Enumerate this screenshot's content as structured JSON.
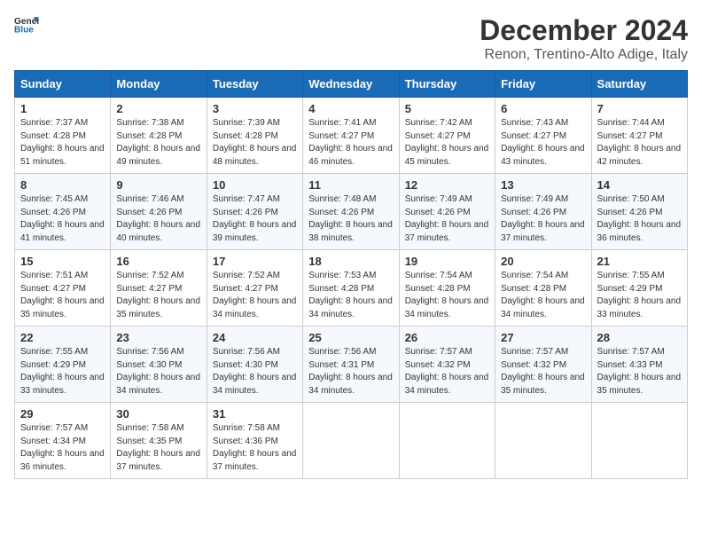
{
  "logo": {
    "text_general": "General",
    "text_blue": "Blue"
  },
  "title": "December 2024",
  "subtitle": "Renon, Trentino-Alto Adige, Italy",
  "days_of_week": [
    "Sunday",
    "Monday",
    "Tuesday",
    "Wednesday",
    "Thursday",
    "Friday",
    "Saturday"
  ],
  "weeks": [
    [
      {
        "day": "1",
        "sunrise": "7:37 AM",
        "sunset": "4:28 PM",
        "daylight": "8 hours and 51 minutes."
      },
      {
        "day": "2",
        "sunrise": "7:38 AM",
        "sunset": "4:28 PM",
        "daylight": "8 hours and 49 minutes."
      },
      {
        "day": "3",
        "sunrise": "7:39 AM",
        "sunset": "4:28 PM",
        "daylight": "8 hours and 48 minutes."
      },
      {
        "day": "4",
        "sunrise": "7:41 AM",
        "sunset": "4:27 PM",
        "daylight": "8 hours and 46 minutes."
      },
      {
        "day": "5",
        "sunrise": "7:42 AM",
        "sunset": "4:27 PM",
        "daylight": "8 hours and 45 minutes."
      },
      {
        "day": "6",
        "sunrise": "7:43 AM",
        "sunset": "4:27 PM",
        "daylight": "8 hours and 43 minutes."
      },
      {
        "day": "7",
        "sunrise": "7:44 AM",
        "sunset": "4:27 PM",
        "daylight": "8 hours and 42 minutes."
      }
    ],
    [
      {
        "day": "8",
        "sunrise": "7:45 AM",
        "sunset": "4:26 PM",
        "daylight": "8 hours and 41 minutes."
      },
      {
        "day": "9",
        "sunrise": "7:46 AM",
        "sunset": "4:26 PM",
        "daylight": "8 hours and 40 minutes."
      },
      {
        "day": "10",
        "sunrise": "7:47 AM",
        "sunset": "4:26 PM",
        "daylight": "8 hours and 39 minutes."
      },
      {
        "day": "11",
        "sunrise": "7:48 AM",
        "sunset": "4:26 PM",
        "daylight": "8 hours and 38 minutes."
      },
      {
        "day": "12",
        "sunrise": "7:49 AM",
        "sunset": "4:26 PM",
        "daylight": "8 hours and 37 minutes."
      },
      {
        "day": "13",
        "sunrise": "7:49 AM",
        "sunset": "4:26 PM",
        "daylight": "8 hours and 37 minutes."
      },
      {
        "day": "14",
        "sunrise": "7:50 AM",
        "sunset": "4:26 PM",
        "daylight": "8 hours and 36 minutes."
      }
    ],
    [
      {
        "day": "15",
        "sunrise": "7:51 AM",
        "sunset": "4:27 PM",
        "daylight": "8 hours and 35 minutes."
      },
      {
        "day": "16",
        "sunrise": "7:52 AM",
        "sunset": "4:27 PM",
        "daylight": "8 hours and 35 minutes."
      },
      {
        "day": "17",
        "sunrise": "7:52 AM",
        "sunset": "4:27 PM",
        "daylight": "8 hours and 34 minutes."
      },
      {
        "day": "18",
        "sunrise": "7:53 AM",
        "sunset": "4:28 PM",
        "daylight": "8 hours and 34 minutes."
      },
      {
        "day": "19",
        "sunrise": "7:54 AM",
        "sunset": "4:28 PM",
        "daylight": "8 hours and 34 minutes."
      },
      {
        "day": "20",
        "sunrise": "7:54 AM",
        "sunset": "4:28 PM",
        "daylight": "8 hours and 34 minutes."
      },
      {
        "day": "21",
        "sunrise": "7:55 AM",
        "sunset": "4:29 PM",
        "daylight": "8 hours and 33 minutes."
      }
    ],
    [
      {
        "day": "22",
        "sunrise": "7:55 AM",
        "sunset": "4:29 PM",
        "daylight": "8 hours and 33 minutes."
      },
      {
        "day": "23",
        "sunrise": "7:56 AM",
        "sunset": "4:30 PM",
        "daylight": "8 hours and 34 minutes."
      },
      {
        "day": "24",
        "sunrise": "7:56 AM",
        "sunset": "4:30 PM",
        "daylight": "8 hours and 34 minutes."
      },
      {
        "day": "25",
        "sunrise": "7:56 AM",
        "sunset": "4:31 PM",
        "daylight": "8 hours and 34 minutes."
      },
      {
        "day": "26",
        "sunrise": "7:57 AM",
        "sunset": "4:32 PM",
        "daylight": "8 hours and 34 minutes."
      },
      {
        "day": "27",
        "sunrise": "7:57 AM",
        "sunset": "4:32 PM",
        "daylight": "8 hours and 35 minutes."
      },
      {
        "day": "28",
        "sunrise": "7:57 AM",
        "sunset": "4:33 PM",
        "daylight": "8 hours and 35 minutes."
      }
    ],
    [
      {
        "day": "29",
        "sunrise": "7:57 AM",
        "sunset": "4:34 PM",
        "daylight": "8 hours and 36 minutes."
      },
      {
        "day": "30",
        "sunrise": "7:58 AM",
        "sunset": "4:35 PM",
        "daylight": "8 hours and 37 minutes."
      },
      {
        "day": "31",
        "sunrise": "7:58 AM",
        "sunset": "4:36 PM",
        "daylight": "8 hours and 37 minutes."
      },
      null,
      null,
      null,
      null
    ]
  ]
}
